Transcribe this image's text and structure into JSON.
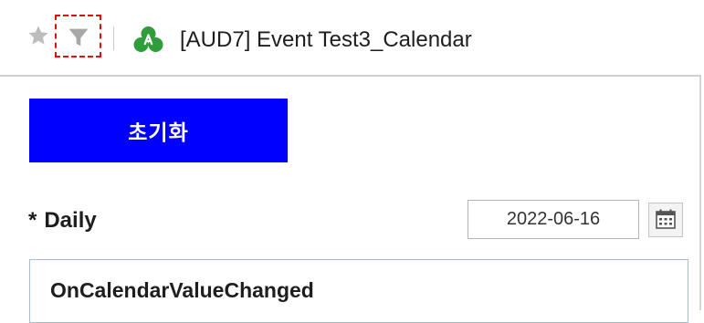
{
  "header": {
    "title": "[AUD7] Event Test3_Calendar",
    "favorite_icon": "star-icon",
    "filter_icon": "filter-icon",
    "app_icon": "app-logo-icon",
    "colors": {
      "star": "#bdbdbd",
      "filter": "#a8a8a8",
      "highlight": "#e01010",
      "app_icon": "#2e9d3a"
    }
  },
  "form": {
    "reset_button_label": "초기화",
    "reset_button_color": "#0000ff",
    "daily_field": {
      "required_marker": "*",
      "label": "Daily",
      "value": "2022-06-16",
      "calendar_icon": "calendar-icon"
    },
    "event_output": "OnCalendarValueChanged"
  }
}
